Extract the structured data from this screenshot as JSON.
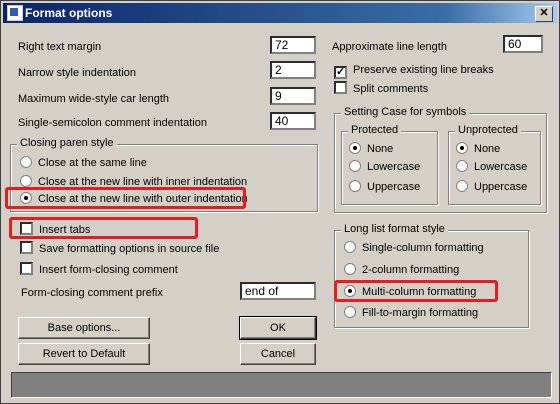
{
  "window": {
    "title": "Format options",
    "close_glyph": "✕"
  },
  "left_fields": [
    {
      "label": "Right text margin",
      "value": "72"
    },
    {
      "label": "Narrow style indentation",
      "value": "2"
    },
    {
      "label": "Maximum wide-style car length",
      "value": "9"
    },
    {
      "label": "Single-semicolon comment indentation",
      "value": "40"
    }
  ],
  "closing_paren": {
    "legend": "Closing paren style",
    "options": [
      {
        "label": "Close at the same line",
        "selected": false
      },
      {
        "label": "Close at the new line with inner indentation",
        "selected": false
      },
      {
        "label": "Close at the new line with outer indentation",
        "selected": true
      }
    ]
  },
  "checks": [
    {
      "label": "Insert tabs",
      "checked": false
    },
    {
      "label": "Save formatting options in source file",
      "checked": false
    },
    {
      "label": "Insert form-closing comment",
      "checked": false
    }
  ],
  "prefix": {
    "label": "Form-closing comment prefix",
    "value": "end of"
  },
  "buttons": {
    "base": "Base options...",
    "ok": "OK",
    "revert": "Revert to Default",
    "cancel": "Cancel"
  },
  "right": {
    "approx_label": "Approximate line length",
    "approx_value": "60",
    "preserve_label": "Preserve existing line breaks",
    "preserve_checked": true,
    "split_label": "Split comments",
    "split_checked": false
  },
  "case_group": {
    "legend": "Setting Case for symbols",
    "protected": {
      "legend": "Protected",
      "options": [
        "None",
        "Lowercase",
        "Uppercase"
      ],
      "selected": 0
    },
    "unprotected": {
      "legend": "Unprotected",
      "options": [
        "None",
        "Lowercase",
        "Uppercase"
      ],
      "selected": 0
    }
  },
  "long_list": {
    "legend": "Long list format style",
    "options": [
      {
        "label": "Single-column formatting",
        "selected": false
      },
      {
        "label": "2-column formatting",
        "selected": false
      },
      {
        "label": "Multi-column formatting",
        "selected": true
      },
      {
        "label": "Fill-to-margin formatting",
        "selected": false
      }
    ]
  },
  "colors": {
    "highlight": "#e31e1e",
    "title_bar": "#0a246a",
    "dialog_bg": "#d4d0c8"
  }
}
